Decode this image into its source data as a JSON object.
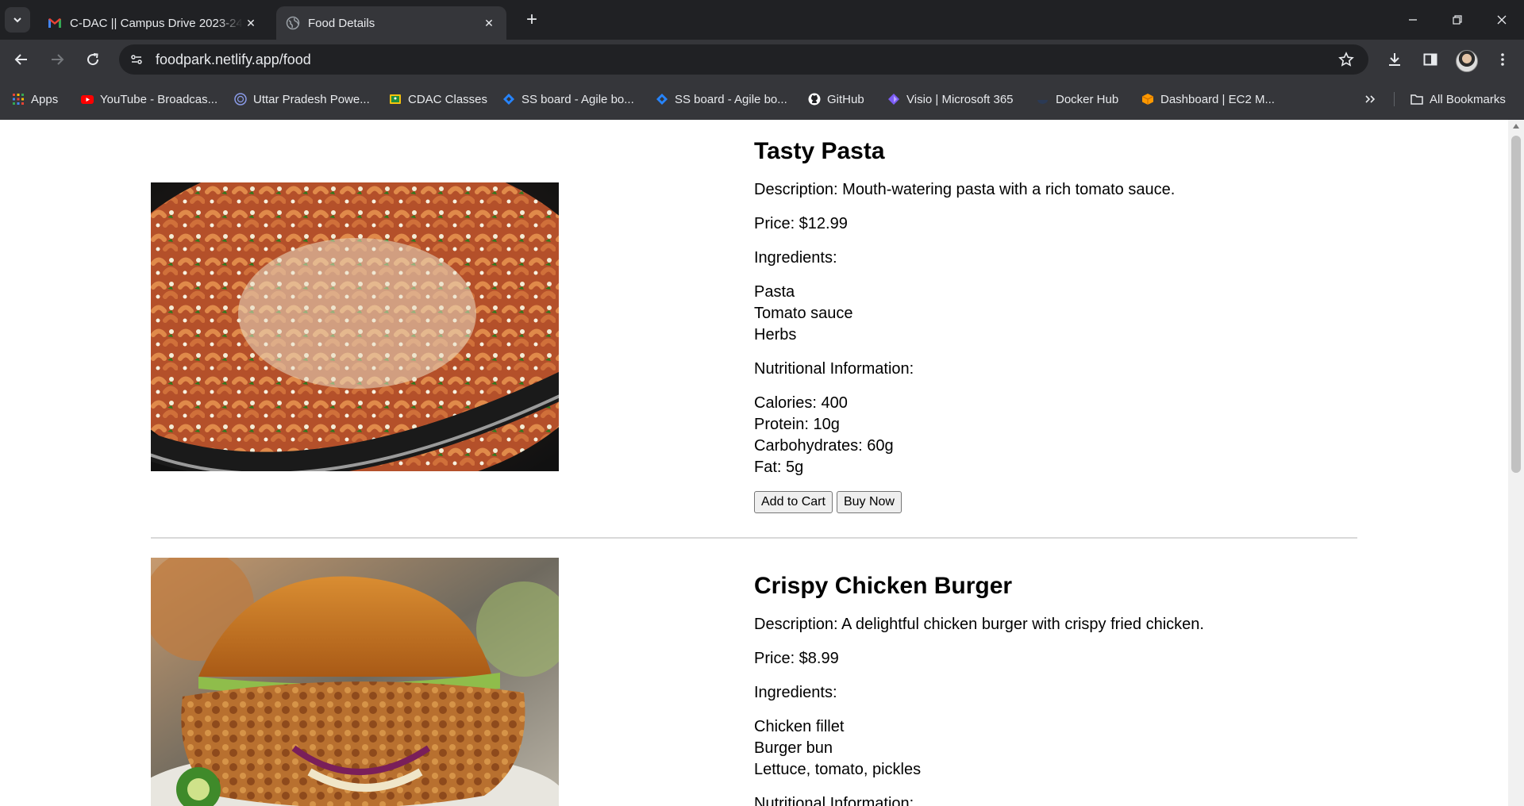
{
  "tabs": [
    {
      "title": "C-DAC || Campus Drive 2023-24",
      "favicon": "gmail-icon",
      "active": false
    },
    {
      "title": "Food Details",
      "favicon": "globe-icon",
      "active": true
    }
  ],
  "toolbar": {
    "url": "foodpark.netlify.app/food"
  },
  "bookmarks": [
    {
      "label": "Apps",
      "icon": "apps-grid-icon",
      "color": "#ea4335"
    },
    {
      "label": "YouTube - Broadcas...",
      "icon": "youtube-icon",
      "color": "#ff0000"
    },
    {
      "label": "Uttar Pradesh Powe...",
      "icon": "uppcl-icon",
      "color": "#6b7ee0"
    },
    {
      "label": "CDAC Classes",
      "icon": "classroom-icon",
      "color": "#f4c20d"
    },
    {
      "label": "SS board - Agile bo...",
      "icon": "jira-icon",
      "color": "#2684ff"
    },
    {
      "label": "SS board - Agile bo...",
      "icon": "jira-icon",
      "color": "#2684ff"
    },
    {
      "label": "GitHub",
      "icon": "github-icon",
      "color": "#ffffff"
    },
    {
      "label": "Visio | Microsoft 365",
      "icon": "visio-icon",
      "color": "#7b5cf5"
    },
    {
      "label": "Docker Hub",
      "icon": "docker-icon",
      "color": "#1d63ed"
    },
    {
      "label": "Dashboard | EC2 M...",
      "icon": "aws-icon",
      "color": "#ff9900"
    }
  ],
  "all_bookmarks": "All Bookmarks",
  "foods": [
    {
      "name": "Tasty Pasta",
      "description": "Description: Mouth-watering pasta with a rich tomato sauce.",
      "price": "Price: $12.99",
      "ingredients_label": "Ingredients:",
      "ingredients": [
        "Pasta",
        "Tomato sauce",
        "Herbs"
      ],
      "nutrition_label": "Nutritional Information:",
      "nutrition": [
        "Calories: 400",
        "Protein: 10g",
        "Carbohydrates: 60g",
        "Fat: 5g"
      ],
      "add_to_cart": "Add to Cart",
      "buy_now": "Buy Now"
    },
    {
      "name": "Crispy Chicken Burger",
      "description": "Description: A delightful chicken burger with crispy fried chicken.",
      "price": "Price: $8.99",
      "ingredients_label": "Ingredients:",
      "ingredients": [
        "Chicken fillet",
        "Burger bun",
        "Lettuce, tomato, pickles"
      ],
      "nutrition_label": "Nutritional Information:"
    }
  ],
  "colors": {
    "chrome_dark": "#202124",
    "chrome_mid": "#35363a",
    "text_light": "#e8eaed"
  }
}
